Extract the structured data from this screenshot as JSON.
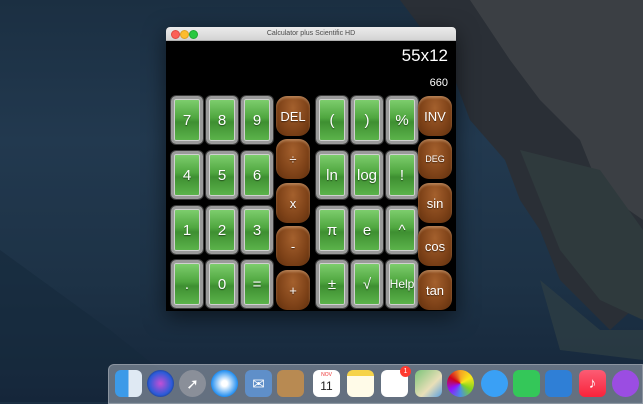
{
  "window": {
    "title": "Calculator plus Scientific HD"
  },
  "display": {
    "expression": "55x12",
    "result": "660"
  },
  "keys": {
    "k7": "7",
    "k8": "8",
    "k9": "9",
    "del": "DEL",
    "lparen": "(",
    "rparen": ")",
    "percent": "%",
    "inv": "INV",
    "k4": "4",
    "k5": "5",
    "k6": "6",
    "divide": "÷",
    "ln": "ln",
    "log": "log",
    "fact": "!",
    "deg": "DEG",
    "k1": "1",
    "k2": "2",
    "k3": "3",
    "multiply": "x",
    "pi": "π",
    "e": "e",
    "pow": "^",
    "sin": "sin",
    "dot": ".",
    "k0": "0",
    "equals": "=",
    "minus": "-",
    "plusminus": "±",
    "sqrt": "√",
    "help": "Help",
    "cos": "cos",
    "plus": "+",
    "tan": "tan"
  },
  "dock": {
    "calendar_month": "NOV",
    "calendar_day": "11",
    "reminders_badge": "1",
    "icons": [
      "finder-icon",
      "siri-icon",
      "launchpad-icon",
      "safari-icon",
      "mail-icon",
      "contacts-icon",
      "calendar-icon",
      "notes-icon",
      "reminders-icon",
      "maps-icon",
      "photos-icon",
      "messages-icon",
      "facetime-icon",
      "keynote-icon",
      "music-icon",
      "podcasts-icon"
    ]
  }
}
